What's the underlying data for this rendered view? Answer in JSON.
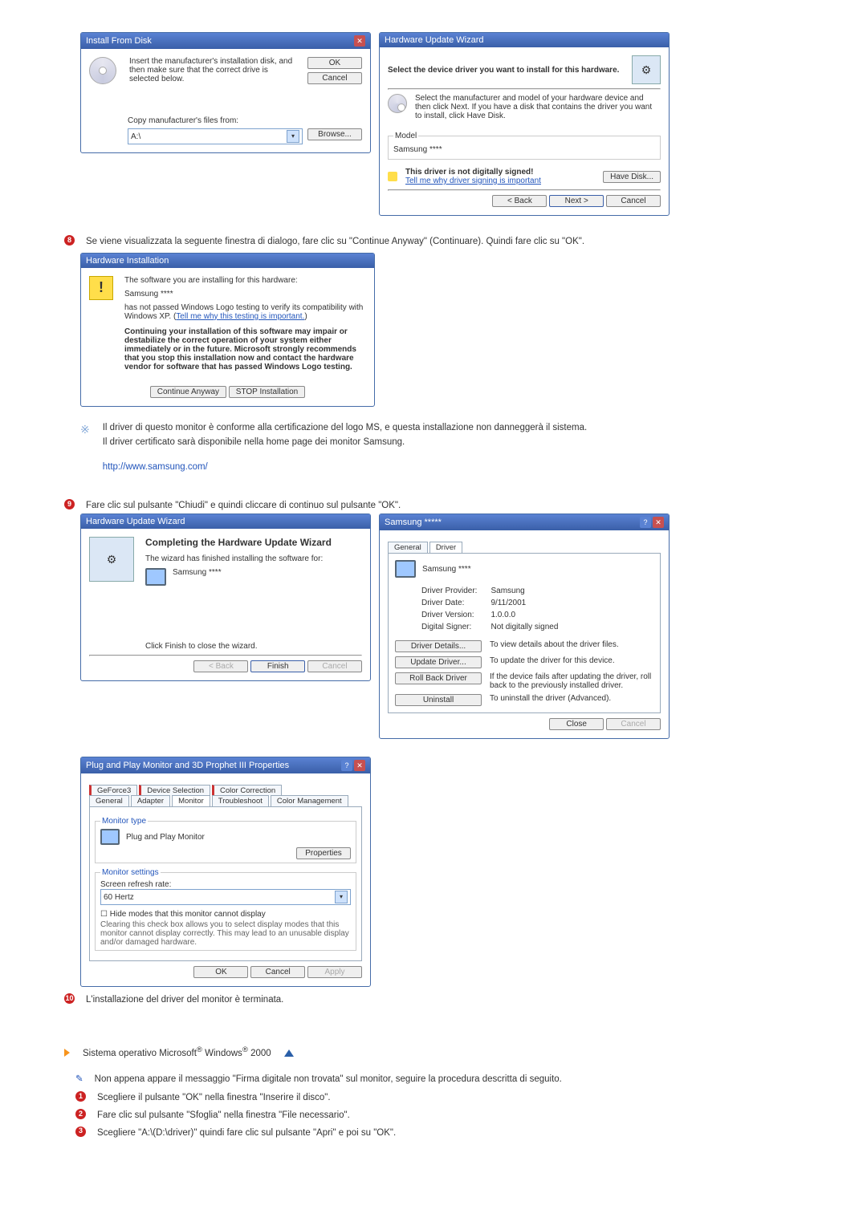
{
  "install_from_disk": {
    "title": "Install From Disk",
    "instruction": "Insert the manufacturer's installation disk, and then make sure that the correct drive is selected below.",
    "ok": "OK",
    "cancel": "Cancel",
    "copy_label": "Copy manufacturer's files from:",
    "path": "A:\\",
    "browse": "Browse..."
  },
  "hw_update_select": {
    "title": "Hardware Update Wizard",
    "heading": "Select the device driver you want to install for this hardware.",
    "instruction": "Select the manufacturer and model of your hardware device and then click Next. If you have a disk that contains the driver you want to install, click Have Disk.",
    "model_label": "Model",
    "model_value": "Samsung ****",
    "not_signed": "This driver is not digitally signed!",
    "tell_me": "Tell me why driver signing is important",
    "have_disk": "Have Disk...",
    "back": "< Back",
    "next": "Next >",
    "cancel": "Cancel"
  },
  "step8": "Se viene visualizzata la seguente finestra di dialogo, fare clic su \"Continue Anyway\" (Continuare). Quindi fare clic su \"OK\".",
  "hw_install": {
    "title": "Hardware Installation",
    "line1": "The software you are installing for this hardware:",
    "device": "Samsung ****",
    "line2": "has not passed Windows Logo testing to verify its compatibility with Windows XP. (",
    "link": "Tell me why this testing is important.",
    "line2_end": ")",
    "bold": "Continuing your installation of this software may impair or destabilize the correct operation of your system either immediately or in the future. Microsoft strongly recommends that you stop this installation now and contact the hardware vendor for software that has passed Windows Logo testing.",
    "continue": "Continue Anyway",
    "stop": "STOP Installation"
  },
  "note_cert": {
    "line1": "Il driver di questo monitor è conforme alla certificazione del logo MS, e questa installazione non danneggerà il sistema.",
    "line2": "Il driver certificato sarà disponibile nella home page dei monitor Samsung.",
    "url": "http://www.samsung.com/"
  },
  "step9": "Fare clic sul pulsante \"Chiudi\" e quindi cliccare di continuo sul pulsante \"OK\".",
  "hw_complete": {
    "title": "Hardware Update Wizard",
    "heading": "Completing the Hardware Update Wizard",
    "sub": "The wizard has finished installing the software for:",
    "device": "Samsung ****",
    "click_finish": "Click Finish to close the wizard.",
    "back": "< Back",
    "finish": "Finish",
    "cancel": "Cancel"
  },
  "driver_props": {
    "title": "Samsung *****",
    "tab_general": "General",
    "tab_driver": "Driver",
    "device": "Samsung ****",
    "provider_l": "Driver Provider:",
    "provider_v": "Samsung",
    "date_l": "Driver Date:",
    "date_v": "9/11/2001",
    "version_l": "Driver Version:",
    "version_v": "1.0.0.0",
    "signer_l": "Digital Signer:",
    "signer_v": "Not digitally signed",
    "b1": "Driver Details...",
    "b1t": "To view details about the driver files.",
    "b2": "Update Driver...",
    "b2t": "To update the driver for this device.",
    "b3": "Roll Back Driver",
    "b3t": "If the device fails after updating the driver, roll back to the previously installed driver.",
    "b4": "Uninstall",
    "b4t": "To uninstall the driver (Advanced).",
    "close": "Close",
    "cancel": "Cancel"
  },
  "display_props": {
    "title": "Plug and Play Monitor and 3D Prophet III Properties",
    "tabs_top": [
      "GeForce3",
      "Device Selection",
      "Color Correction"
    ],
    "tabs_bottom": [
      "General",
      "Adapter",
      "Monitor",
      "Troubleshoot",
      "Color Management"
    ],
    "mt_label": "Monitor type",
    "mt_value": "Plug and Play Monitor",
    "properties": "Properties",
    "ms_label": "Monitor settings",
    "refresh_l": "Screen refresh rate:",
    "refresh_v": "60 Hertz",
    "hide": "Hide modes that this monitor cannot display",
    "hide_desc": "Clearing this check box allows you to select display modes that this monitor cannot display correctly. This may lead to an unusable display and/or damaged hardware.",
    "ok": "OK",
    "cancel": "Cancel",
    "apply": "Apply"
  },
  "step10": "L'installazione del driver del monitor è terminata.",
  "os2000": {
    "heading_pre": "Sistema operativo Microsoft",
    "heading_mid": " Windows",
    "heading_post": " 2000",
    "intro": "Non appena appare il messaggio \"Firma digitale non trovata\" sul monitor, seguire la procedura descritta di seguito.",
    "s1": "Scegliere il pulsante \"OK\" nella finestra \"Inserire il disco\".",
    "s2": "Fare clic sul pulsante \"Sfoglia\" nella finestra \"File necessario\".",
    "s3": "Scegliere \"A:\\(D:\\driver)\" quindi fare clic sul pulsante \"Apri\" e poi su \"OK\"."
  },
  "numbers": {
    "n1": "1",
    "n2": "2",
    "n3": "3",
    "n8": "8",
    "n9": "9",
    "n10": "10"
  },
  "glyphs": {
    "note": "✎",
    "reg": "®",
    "checkbox": "☐"
  }
}
